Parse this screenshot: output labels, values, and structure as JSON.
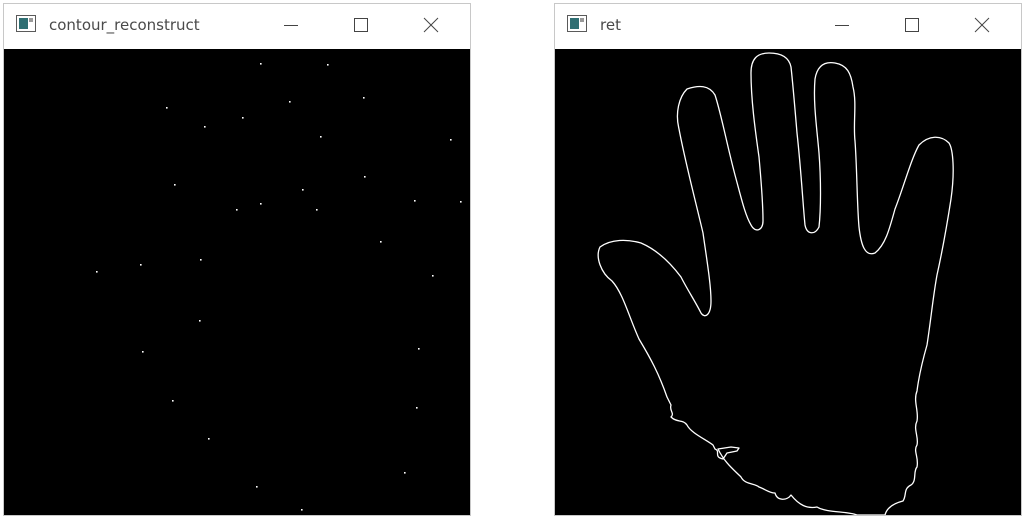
{
  "windows": [
    {
      "title": "contour_reconstruct",
      "content": "scattered white contour points on black background"
    },
    {
      "title": "ret",
      "content": "white hand contour outline on black background"
    }
  ],
  "colors": {
    "canvas_background": "#000000",
    "drawing": "#ffffff",
    "titlebar": "#ffffff",
    "title_text": "#4a4a4a"
  },
  "icons": {
    "app": "app-window-icon",
    "minimize": "minimize-icon",
    "maximize": "maximize-icon",
    "close": "close-icon"
  }
}
